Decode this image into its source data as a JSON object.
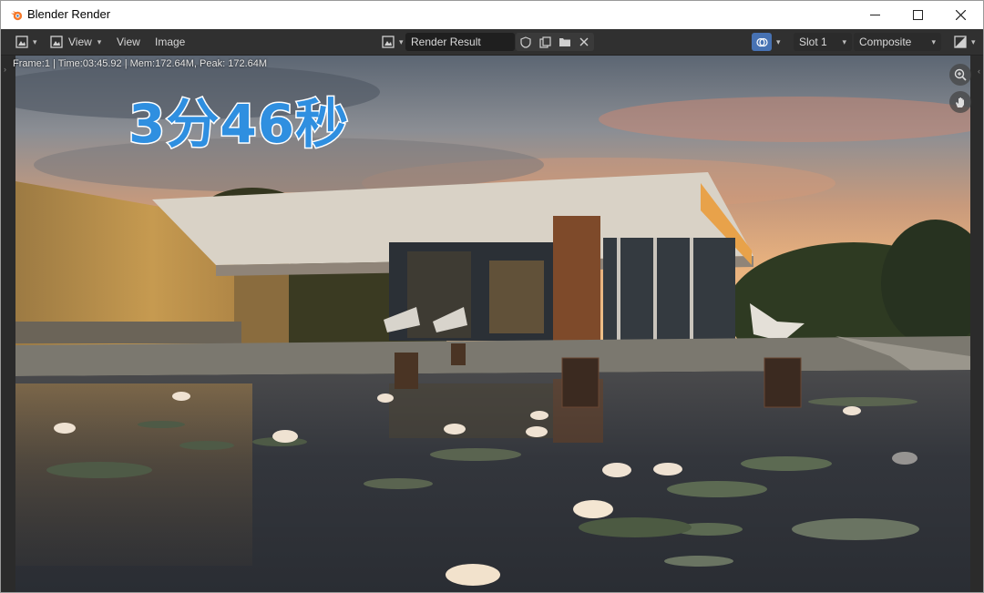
{
  "window": {
    "title": "Blender Render",
    "min_icon": "minimize-icon",
    "max_icon": "maximize-icon",
    "close_icon": "close-icon"
  },
  "toolbar": {
    "editor_type_icon": "image-editor-icon",
    "view_label": "View",
    "menu_view": "View",
    "menu_image": "Image",
    "image_name": "Render Result",
    "slot": "Slot 1",
    "pass": "Composite"
  },
  "viewport": {
    "stats": "Frame:1 | Time:03:45.92 | Mem:172.64M, Peak: 172.64M",
    "overlay_text": "3分46秒",
    "zoom_icon": "zoom-icon",
    "pan_icon": "hand-icon"
  },
  "colors": {
    "overlay_fill": "#2f8fe0",
    "overlay_stroke": "#ffffff",
    "toolbar_bg": "#303030"
  }
}
